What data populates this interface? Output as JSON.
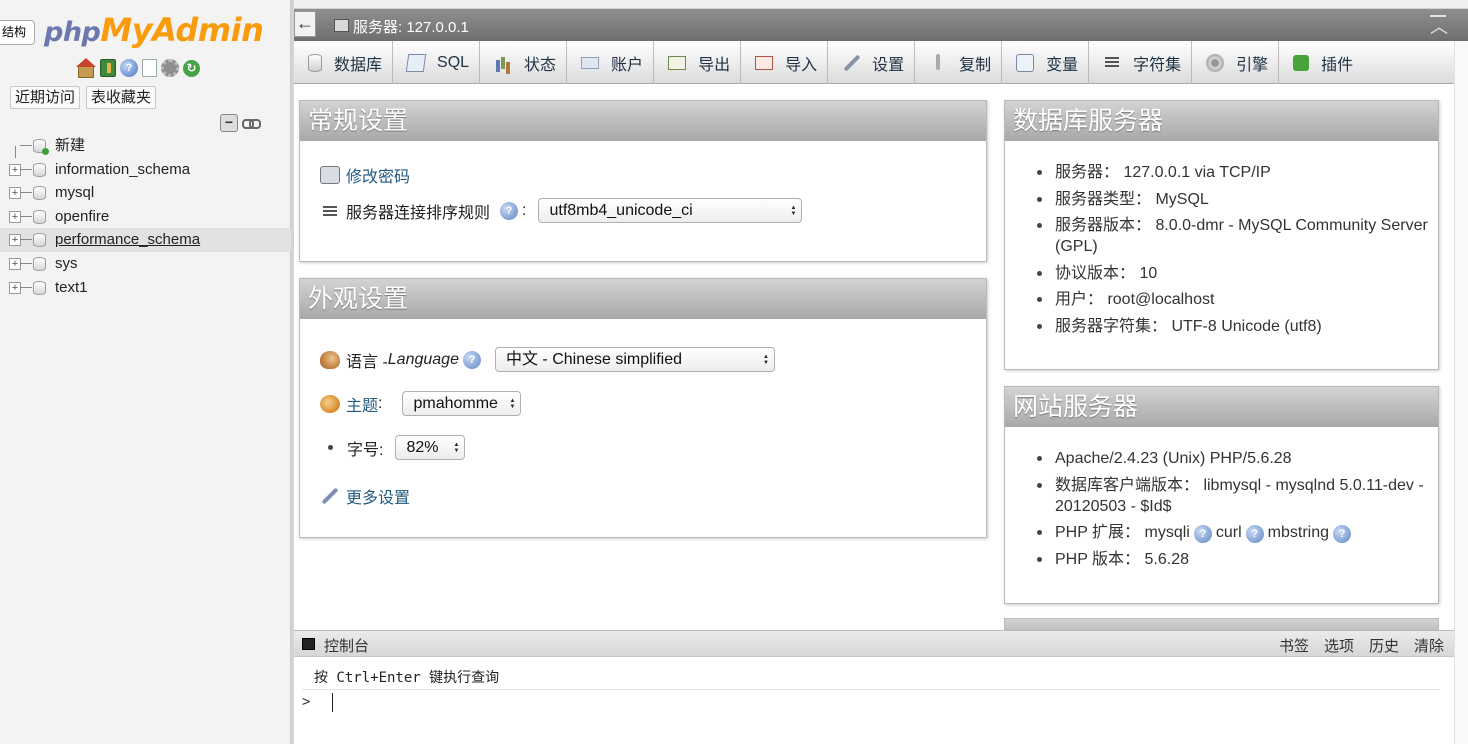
{
  "nav": {
    "structure_tab": "结构",
    "logo_php": "php",
    "logo_myadmin": "MyAdmin",
    "recent_btn": "近期访问",
    "favorites_btn": "表收藏夹",
    "collapse_symbol": "−",
    "tree": [
      {
        "label": "新建",
        "type": "new"
      },
      {
        "label": "information_schema",
        "type": "db"
      },
      {
        "label": "mysql",
        "type": "db"
      },
      {
        "label": "openfire",
        "type": "db"
      },
      {
        "label": "performance_schema",
        "type": "db",
        "highlighted": true
      },
      {
        "label": "sys",
        "type": "db"
      },
      {
        "label": "text1",
        "type": "db"
      }
    ],
    "expand_symbol": "+"
  },
  "header": {
    "back_symbol": "←",
    "server_label": "服务器: 127.0.0.1"
  },
  "menu": {
    "tabs": [
      {
        "label": "数据库",
        "icon": "database-icon"
      },
      {
        "label": "SQL",
        "icon": "sql-icon"
      },
      {
        "label": "状态",
        "icon": "status-icon"
      },
      {
        "label": "账户",
        "icon": "accounts-icon"
      },
      {
        "label": "导出",
        "icon": "export-icon"
      },
      {
        "label": "导入",
        "icon": "import-icon"
      },
      {
        "label": "设置",
        "icon": "settings-icon"
      },
      {
        "label": "复制",
        "icon": "replication-icon"
      },
      {
        "label": "变量",
        "icon": "variables-icon"
      },
      {
        "label": "字符集",
        "icon": "charset-icon"
      },
      {
        "label": "引擎",
        "icon": "engine-icon"
      },
      {
        "label": "插件",
        "icon": "plugins-icon"
      }
    ]
  },
  "general_settings": {
    "title": "常规设置",
    "change_password": "修改密码",
    "collation_label": "服务器连接排序规则",
    "collation_colon": ":",
    "collation_value": "utf8mb4_unicode_ci"
  },
  "appearance_settings": {
    "title": "外观设置",
    "language_label": "语言 - ",
    "language_en": "Language",
    "language_value": "中文 - Chinese simplified",
    "theme_label": "主题",
    "theme_colon": ":",
    "theme_value": "pmahomme",
    "font_size_label": "字号:",
    "font_size_value": "82%",
    "more_settings": "更多设置"
  },
  "db_server": {
    "title": "数据库服务器",
    "items": [
      "服务器： 127.0.0.1 via TCP/IP",
      "服务器类型： MySQL",
      "服务器版本： 8.0.0-dmr - MySQL Community Server (GPL)",
      "协议版本： 10",
      "用户： root@localhost",
      "服务器字符集： UTF-8 Unicode (utf8)"
    ]
  },
  "web_server": {
    "title": "网站服务器",
    "item1": "Apache/2.4.23 (Unix) PHP/5.6.28",
    "item2": "数据库客户端版本： libmysql - mysqlnd 5.0.11-dev - 20120503 - $Id$",
    "php_ext_label": "PHP 扩展： ",
    "ext1": "mysqli",
    "ext2": "curl",
    "ext3": "mbstring",
    "php_version": "PHP 版本： 5.6.28"
  },
  "console": {
    "title": "控制台",
    "actions": [
      "书签",
      "选项",
      "历史",
      "清除"
    ],
    "hint": "按 Ctrl+Enter 键执行查询",
    "prompt": ">"
  },
  "help_glyph": "?"
}
